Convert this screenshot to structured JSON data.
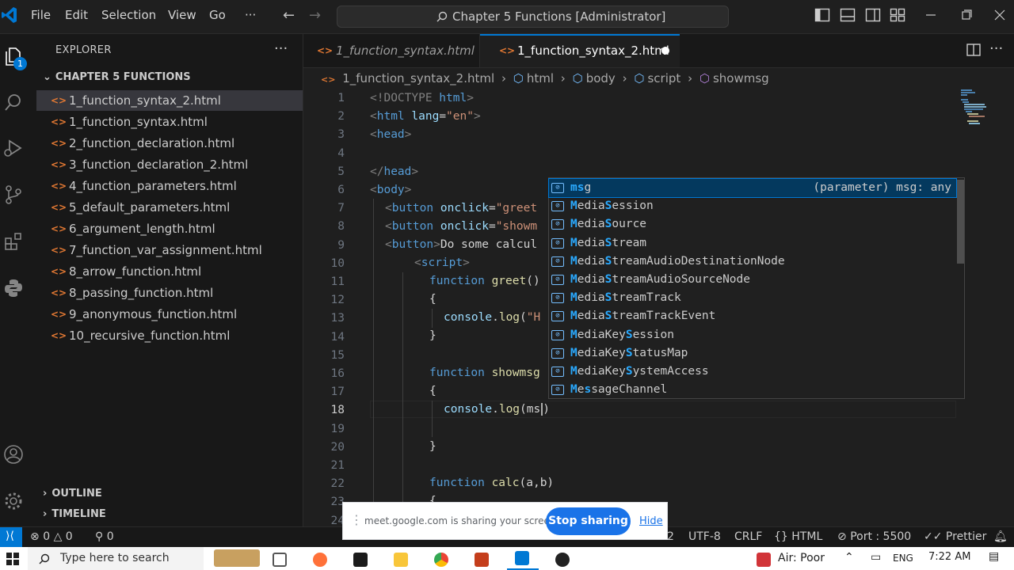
{
  "menu": [
    "File",
    "Edit",
    "Selection",
    "View",
    "Go",
    "···"
  ],
  "command_center": "Chapter 5 Functions [Administrator]",
  "explorer": {
    "title": "EXPLORER",
    "more": "···",
    "folder": "CHAPTER 5 FUNCTIONS",
    "files": [
      "1_function_syntax_2.html",
      "1_function_syntax.html",
      "2_function_declaration.html",
      "3_function_declaration_2.html",
      "4_function_parameters.html",
      "5_default_parameters.html",
      "6_argument_length.html",
      "7_function_var_assignment.html",
      "8_arrow_function.html",
      "8_passing_function.html",
      "9_anonymous_function.html",
      "10_recursive_function.html"
    ],
    "active_file": "1_function_syntax_2.html",
    "outline": "OUTLINE",
    "timeline": "TIMELINE"
  },
  "activity_badge": "1",
  "tabs": [
    {
      "label": "1_function_syntax.html",
      "active": false
    },
    {
      "label": "1_function_syntax_2.html",
      "active": true
    }
  ],
  "breadcrumb": [
    "1_function_syntax_2.html",
    "html",
    "body",
    "script",
    "showmsg"
  ],
  "line_numbers": [
    "1",
    "2",
    "3",
    "4",
    "5",
    "6",
    "7",
    "8",
    "9",
    "10",
    "11",
    "12",
    "13",
    "14",
    "15",
    "16",
    "17",
    "18",
    "19",
    "20",
    "21",
    "22",
    "23",
    "24"
  ],
  "current_line": "18",
  "code": {
    "l1_a": "<!DOCTYPE",
    "l1_b": " html",
    "l1_c": ">",
    "l2_a": "<",
    "l2_b": "html",
    "l2_c": " lang",
    "l2_d": "=",
    "l2_e": "\"en\"",
    "l2_f": ">",
    "l3_a": "<",
    "l3_b": "head",
    "l3_c": ">",
    "l5_a": "</",
    "l5_b": "head",
    "l5_c": ">",
    "l6_a": "<",
    "l6_b": "body",
    "l6_c": ">",
    "l7_a": "<",
    "l7_b": "button",
    "l7_c": " onclick",
    "l7_d": "=",
    "l7_e": "\"greet",
    "l8_a": "<",
    "l8_b": "button",
    "l8_c": " onclick",
    "l8_d": "=",
    "l8_e": "\"showm",
    "l9_a": "<",
    "l9_b": "button",
    "l9_c": ">",
    "l9_d": "Do some calcul",
    "l10_a": "<",
    "l10_b": "script",
    "l10_c": ">",
    "l11_a": "function",
    "l11_b": " greet",
    "l11_c": "()",
    "l12": "{",
    "l13_a": "console",
    "l13_b": ".",
    "l13_c": "log",
    "l13_d": "(",
    "l13_e": "\"H",
    "l14": "}",
    "l16_a": "function",
    "l16_b": " showmsg",
    "l17": "{",
    "l18_a": "console",
    "l18_b": ".",
    "l18_c": "log",
    "l18_d": "(ms",
    "l20": "}",
    "l22_a": "function",
    "l22_b": " calc",
    "l22_c": "(a,b)",
    "l23": "{"
  },
  "suggestions": [
    {
      "label": "msg",
      "detail": "(parameter) msg: any",
      "selected": true
    },
    {
      "label": "MediaSession"
    },
    {
      "label": "MediaSource"
    },
    {
      "label": "MediaStream"
    },
    {
      "label": "MediaStreamAudioDestinationNode"
    },
    {
      "label": "MediaStreamAudioSourceNode"
    },
    {
      "label": "MediaStreamTrack"
    },
    {
      "label": "MediaStreamTrackEvent"
    },
    {
      "label": "MediaKeySession"
    },
    {
      "label": "MediaKeyStatusMap"
    },
    {
      "label": "MediaKeySystemAccess"
    },
    {
      "label": "MessageChannel"
    }
  ],
  "suggest_icon": "[⊘]",
  "status": {
    "errors": "0",
    "warnings": "0",
    "ports": "0",
    "spaces": "2",
    "encoding": "UTF-8",
    "eol": "CRLF",
    "language": "HTML",
    "port": "Port : 5500",
    "prettier": "Prettier"
  },
  "share_bar": {
    "message": "meet.google.com is sharing your screen.",
    "stop": "Stop sharing",
    "hide": "Hide"
  },
  "taskbar": {
    "search_placeholder": "Type here to search",
    "weather": "Air: Poor",
    "lang": "ENG",
    "time": "7:22 AM"
  },
  "colors": {
    "accent": "#0078d4",
    "html_tag": "#569cd6",
    "attribute": "#9cdcfe",
    "string": "#ce9178",
    "function": "#dcdcaa",
    "file_icon": "#e37933",
    "stop_button": "#1a73e8"
  }
}
